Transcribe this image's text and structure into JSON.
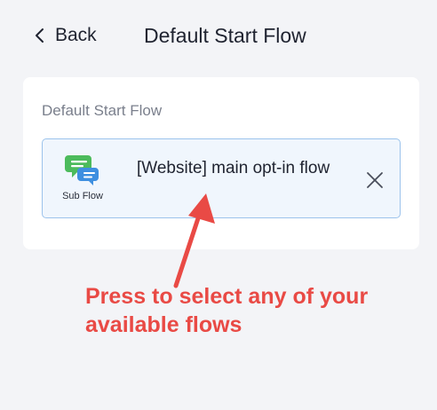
{
  "header": {
    "back_label": "Back",
    "title": "Default Start Flow"
  },
  "card": {
    "title": "Default Start Flow",
    "flow": {
      "type": "Sub Flow",
      "name": "[Website] main opt-in flow",
      "icon": "chat-bubbles-icon"
    },
    "clear_icon": "close-icon"
  },
  "annotation": {
    "text": "Press to select any of your available flows",
    "color": "#e94a45"
  },
  "colors": {
    "background": "#f3f4f7",
    "selected_border": "#9cc3ec",
    "selected_fill": "#f0f6fd"
  }
}
